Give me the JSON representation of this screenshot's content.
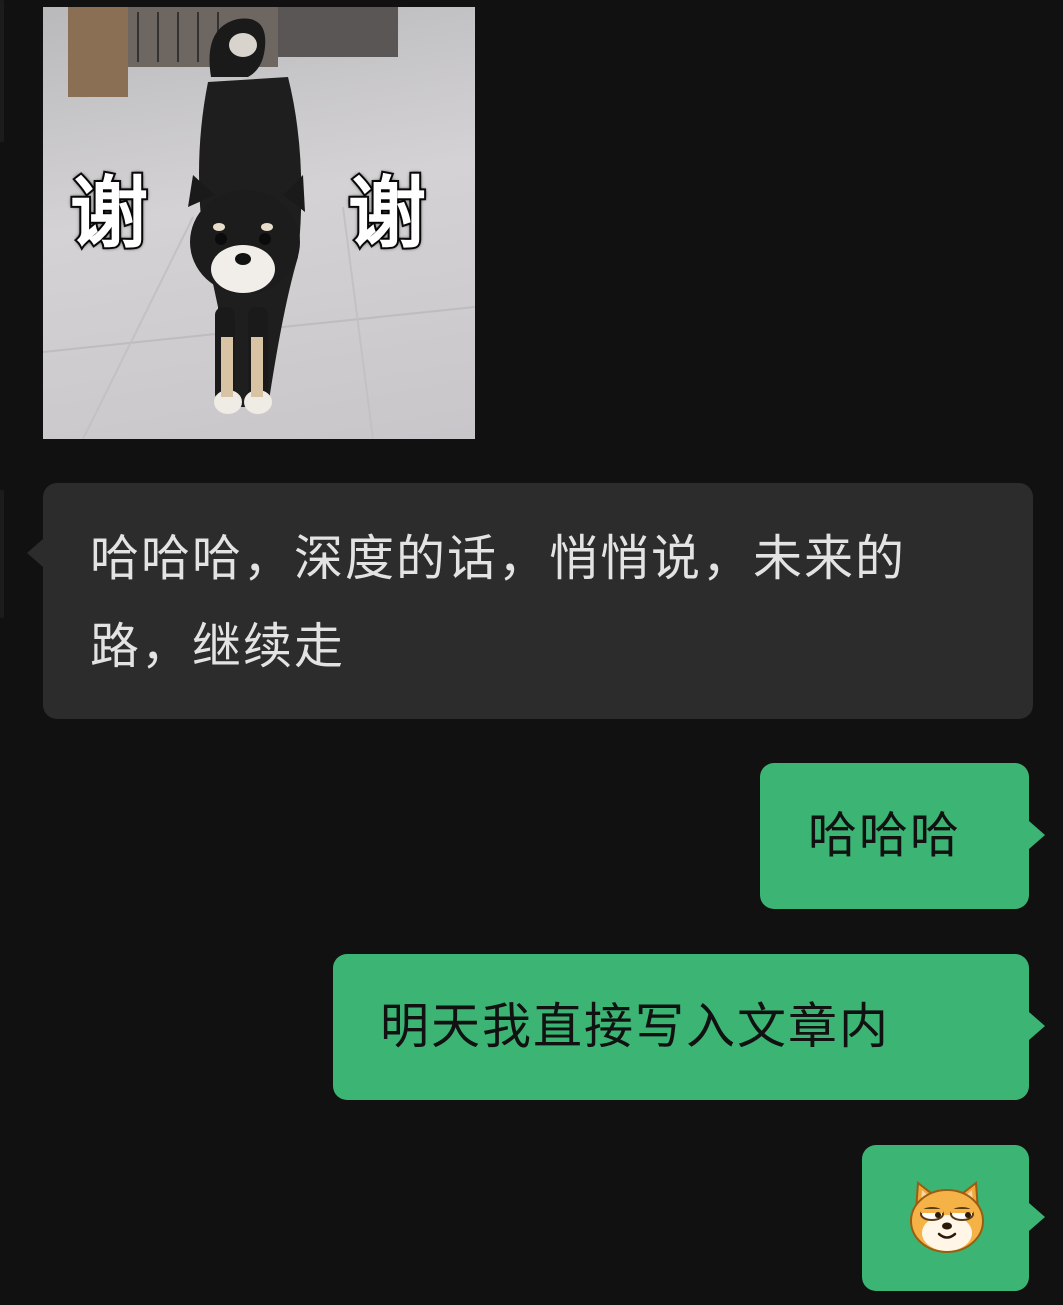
{
  "chat": {
    "messages": [
      {
        "type": "sticker",
        "direction": "incoming",
        "caption_left": "谢",
        "caption_right": "谢",
        "subject": "black-shiba-dog-stretching"
      },
      {
        "type": "text",
        "direction": "incoming",
        "text": "哈哈哈，深度的话，悄悄说，未来的路，继续走"
      },
      {
        "type": "text",
        "direction": "outgoing",
        "text": "哈哈哈"
      },
      {
        "type": "text",
        "direction": "outgoing",
        "text": "明天我直接写入文章内"
      },
      {
        "type": "emoji",
        "direction": "outgoing",
        "icon": "smug-doge-emoji-icon"
      }
    ]
  },
  "colors": {
    "background": "#111111",
    "incoming_bubble": "#2c2c2c",
    "outgoing_bubble": "#3bb474",
    "incoming_text": "#e3e3e3",
    "outgoing_text": "#111111"
  }
}
